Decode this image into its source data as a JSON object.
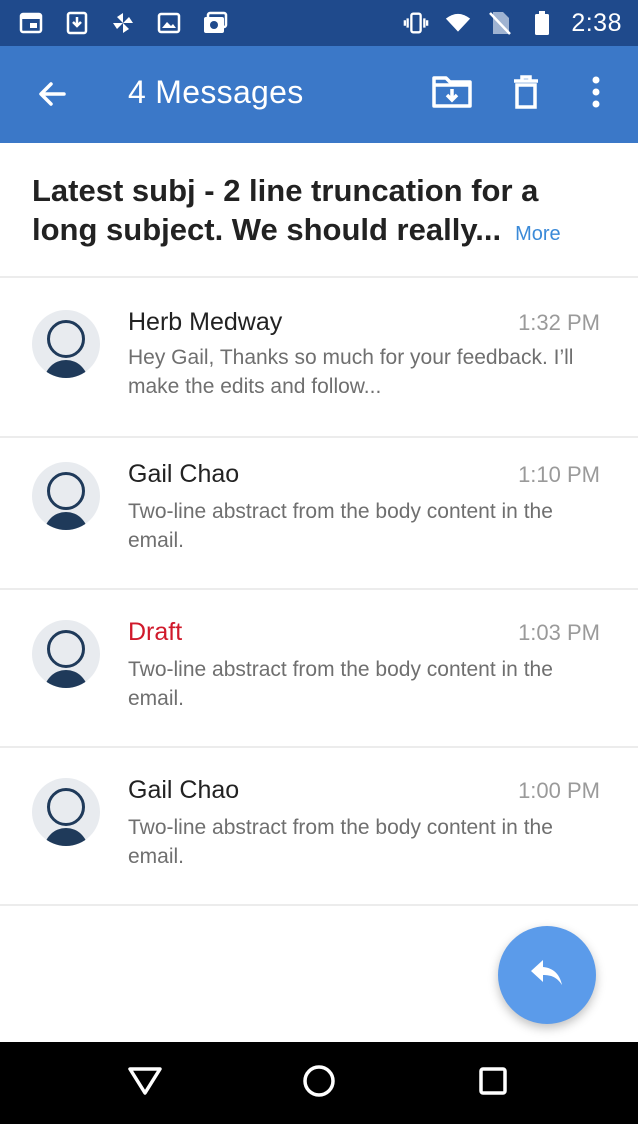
{
  "status_bar": {
    "time": "2:38",
    "left_icons": [
      "window-icon",
      "download-icon",
      "pinwheel-icon",
      "image-icon",
      "photo-stack-icon"
    ],
    "right_icons": [
      "vibrate-icon",
      "wifi-icon",
      "no-sim-icon",
      "battery-icon"
    ]
  },
  "app_bar": {
    "title": "4 Messages",
    "back_icon": "arrow-left-icon",
    "actions": [
      "move-to-folder-icon",
      "trash-icon",
      "more-vert-icon"
    ],
    "color": "#3b78c8"
  },
  "conversation": {
    "subject": "Latest subj - 2 line truncation for a long subject. We should really...",
    "more_label": "More"
  },
  "messages": [
    {
      "sender": "Herb Medway",
      "time": "1:32 PM",
      "abstract": "Hey Gail, Thanks so much for your feedback. I’ll make the edits and follow...",
      "is_draft": false
    },
    {
      "sender": "Gail Chao",
      "time": "1:10 PM",
      "abstract": "Two-line abstract from the body content in the email.",
      "is_draft": false
    },
    {
      "sender": "Draft",
      "time": "1:03 PM",
      "abstract": "Two-line abstract from the body content in the email.",
      "is_draft": true
    },
    {
      "sender": "Gail Chao",
      "time": "1:00 PM",
      "abstract": "Two-line abstract from the body content in the email.",
      "is_draft": false
    }
  ],
  "fab": {
    "icon": "reply-icon",
    "color": "#5b9bea"
  },
  "nav_bar": {
    "buttons": [
      "back-triangle-icon",
      "home-circle-icon",
      "recents-square-icon"
    ]
  }
}
